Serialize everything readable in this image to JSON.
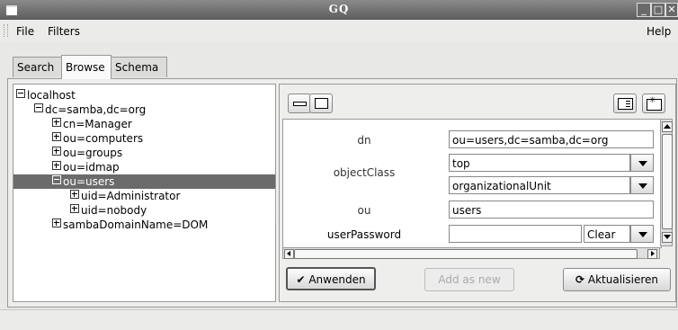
{
  "window": {
    "title": "GQ"
  },
  "menu": {
    "file": "File",
    "filters": "Filters",
    "help": "Help"
  },
  "tabs": [
    "Search",
    "Browse",
    "Schema"
  ],
  "tree": {
    "root": "localhost",
    "base": "dc=samba,dc=org",
    "children": [
      "cn=Manager",
      "ou=computers",
      "ou=groups",
      "ou=idmap",
      "ou=users"
    ],
    "users_children": [
      "uid=Administrator",
      "uid=nobody"
    ],
    "last": "sambaDomainName=DOM",
    "selected": "ou=users"
  },
  "form": {
    "dn_label": "dn",
    "dn_value": "ou=users,dc=samba,dc=org",
    "objectclass_label": "objectClass",
    "objectclass_values": [
      "top",
      "organizationalUnit"
    ],
    "ou_label": "ou",
    "ou_value": "users",
    "userpassword_label": "userPassword",
    "userpassword_value": "",
    "hash_option": "Clear"
  },
  "buttons": {
    "apply": "Anwenden",
    "add_new": "Add as new",
    "refresh": "Aktualisieren"
  },
  "icons": [
    "minimize-icon",
    "maximize-icon",
    "close-icon",
    "check-icon",
    "refresh-icon"
  ]
}
